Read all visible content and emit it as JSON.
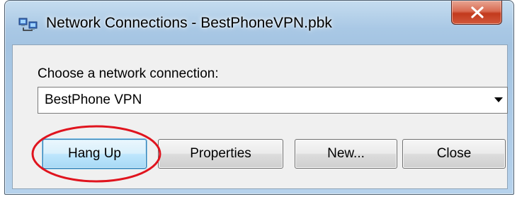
{
  "window": {
    "title": "Network Connections - BestPhoneVPN.pbk",
    "app_icon": "network-connections-icon",
    "close_icon": "close-icon"
  },
  "dialog": {
    "choose_label": "Choose a network connection:",
    "connection_selected": "BestPhone VPN",
    "dropdown_icon": "chevron-down-icon"
  },
  "buttons": {
    "hang_up": "Hang Up",
    "properties": "Properties",
    "new": "New...",
    "close": "Close"
  },
  "annotation": {
    "highlight_color": "#e0141e",
    "highlight_target": "hang-up-button"
  },
  "colors": {
    "title_bar": "#a9c8e5",
    "close_button": "#c8432a",
    "default_button_border": "#3c7fb1",
    "client_background": "#f0f0f0"
  }
}
